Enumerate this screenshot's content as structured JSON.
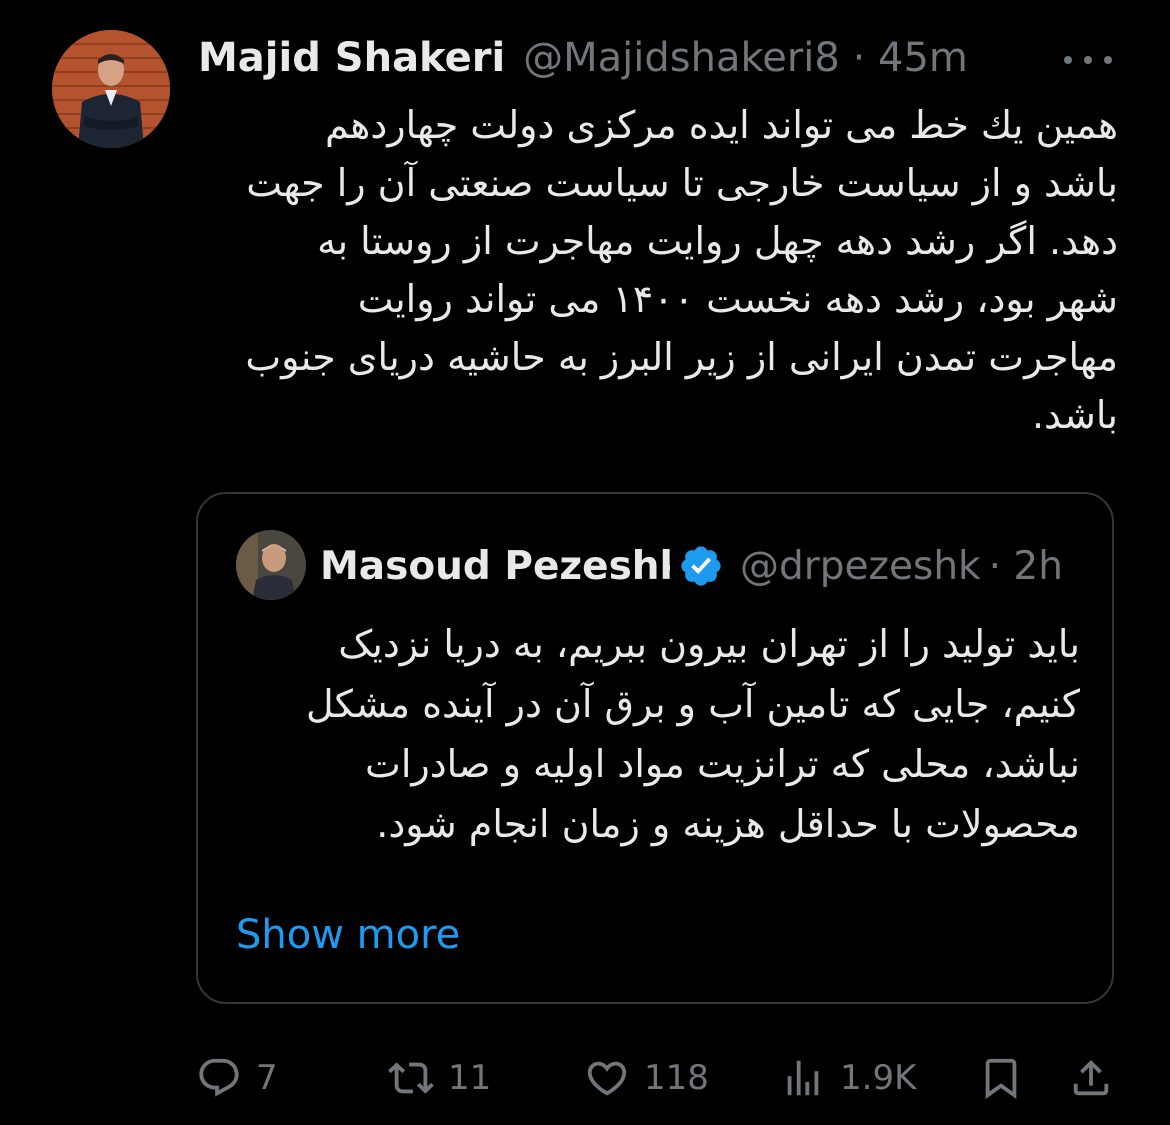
{
  "tweet": {
    "author_name": "Majid Shakeri",
    "author_meta": "@Majidshakeri8 · 45m",
    "more_icon": "more-icon",
    "lines": [
      "همین یك خط می تواند ایده مرکزی دولت چهاردهم",
      "باشد و از سیاست خارجی تا سیاست صنعتی آن را جهت",
      "دهد. اگر رشد دهه چهل روایت مهاجرت از روستا به",
      "شهر بود، رشد دهه نخست ۱۴۰۰ می تواند روایت",
      "مهاجرت تمدن ایرانی از زیر البرز به حاشیه دریای جنوب",
      "باشد."
    ]
  },
  "quoted": {
    "name": "Masoud Pezeshk",
    "handle": "@drpezeshk",
    "time": "· 2h",
    "verified_icon": "verified-badge-icon",
    "lines": [
      "باید تولید را از تهران بیرون ببریم، به دریا نزدیک",
      "کنیم، جایی که تامین آب و برق آن در آینده مشکل",
      "نباشد، محلی که ترانزیت مواد اولیه و صادرات",
      "محصولات با حداقل هزینه و زمان انجام شود."
    ],
    "show_more": "Show more"
  },
  "actions": {
    "replies": "7",
    "reposts": "11",
    "likes": "118",
    "views": "1.9K"
  },
  "colors": {
    "background": "#000000",
    "text": "#e7e9ea",
    "muted": "#71767b",
    "accent": "#1d9bf0",
    "border": "#333639"
  }
}
